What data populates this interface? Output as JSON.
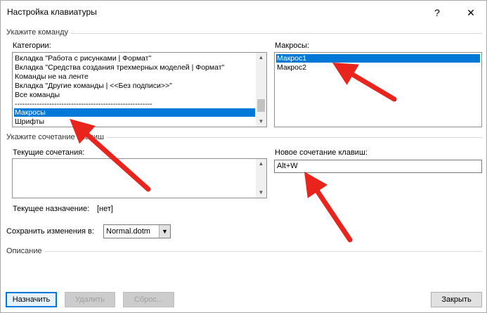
{
  "window": {
    "title": "Настройка клавиатуры",
    "help_label": "?",
    "close_label": "✕"
  },
  "command_section": {
    "label": "Укажите команду",
    "categories_label": "Категории:",
    "categories": [
      "Вкладка \"Работа с рисунками | Формат\"",
      "Вкладка \"Средства создания трехмерных моделей | Формат\"",
      "Команды не на ленте",
      "Вкладка \"Другие команды | <<Без подписи>>\"",
      "Все команды",
      "--------------------------------------------------------",
      "Макросы",
      "Шрифты"
    ],
    "selected_category": "Макросы",
    "macros_label": "Макросы:",
    "macros": [
      "Макрос1",
      "Макрос2"
    ],
    "selected_macro": "Макрос1"
  },
  "shortcut_section": {
    "label": "Укажите сочетание клавиш",
    "current_label": "Текущие сочетания:",
    "new_label": "Новое сочетание клавиш:",
    "new_value": "Alt+W",
    "assignment_label": "Текущее назначение:",
    "assignment_value": "[нет]"
  },
  "save": {
    "label": "Сохранить изменения в:",
    "value": "Normal.dotm"
  },
  "description": {
    "label": "Описание"
  },
  "buttons": {
    "assign": "Назначить",
    "remove": "Удалить",
    "reset": "Сброс...",
    "close": "Закрыть"
  },
  "colors": {
    "selection": "#0078d7",
    "annotation_arrow": "#e8241c"
  }
}
